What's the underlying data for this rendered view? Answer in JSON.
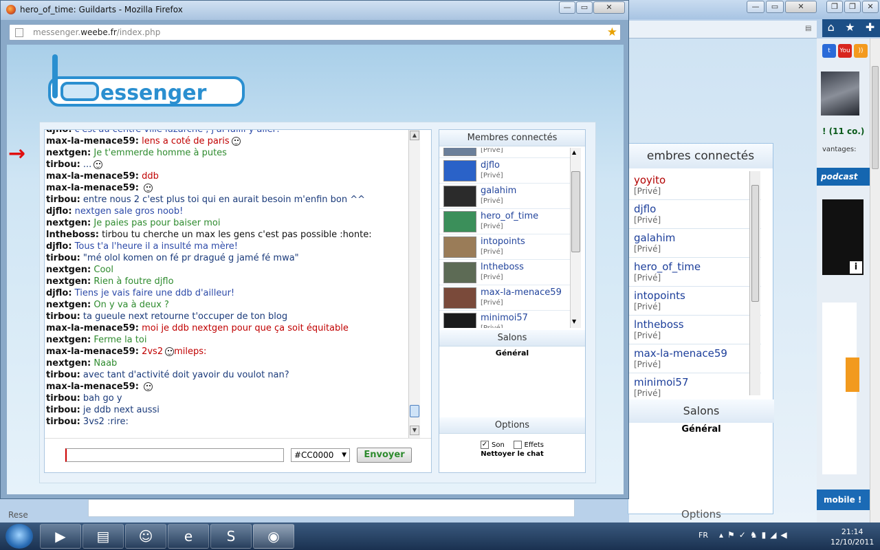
{
  "background_window": {
    "members_title": "embres connectés",
    "members": [
      {
        "name": "yoyito",
        "status": "[Privé]",
        "color": "#b20000"
      },
      {
        "name": "djflo",
        "status": "[Privé]",
        "color": "#1c3e9a"
      },
      {
        "name": "galahim",
        "status": "[Privé]",
        "color": "#1c3e9a"
      },
      {
        "name": "hero_of_time",
        "status": "[Privé]",
        "color": "#1c3e9a"
      },
      {
        "name": "intopoints",
        "status": "[Privé]",
        "color": "#1c3e9a"
      },
      {
        "name": "lntheboss",
        "status": "[Privé]",
        "color": "#1c3e9a"
      },
      {
        "name": "max-la-menace59",
        "status": "[Privé]",
        "color": "#1c3e9a"
      },
      {
        "name": "minimoi57",
        "status": "[Privé]",
        "color": "#1c3e9a"
      }
    ],
    "salons_title": "Salons",
    "general": "Général",
    "options_title": "Options",
    "online_count": "! (11 co.)",
    "advantages": "vantages:",
    "podcast": "podcast",
    "mobile": "mobile !",
    "bottom_text": "Rese"
  },
  "firefox": {
    "window_title": "hero_of_time: Guildarts - Mozilla Firefox",
    "url_prefix": "messenger.",
    "url_domain": "weebe.fr",
    "url_path": "/index.php"
  },
  "chat": {
    "messages": [
      {
        "user": "djflo:",
        "text": "c'est au centre ville luzarche , j'ai failli y aller!",
        "color": "#2c4aa8",
        "smiley": false
      },
      {
        "user": "max-la-menace59:",
        "text": "lens a coté de paris",
        "color": "#c00000",
        "smiley": true
      },
      {
        "user": "nextgen:",
        "text": "Je t'emmerde homme à putes",
        "color": "#2e8b2e",
        "smiley": false
      },
      {
        "user": "tirbou:",
        "text": "...",
        "color": "#1a3a7a",
        "smiley": true
      },
      {
        "user": "max-la-menace59:",
        "text": "ddb",
        "color": "#c00000",
        "smiley": false
      },
      {
        "user": "max-la-menace59:",
        "text": "",
        "color": "#c00000",
        "smiley": true
      },
      {
        "user": "tirbou:",
        "text": "entre nous 2 c'est plus toi qui en aurait besoin m'enfin bon ^^",
        "color": "#1a3a7a",
        "smiley": false
      },
      {
        "user": "djflo:",
        "text": "nextgen sale gros noob!",
        "color": "#2c4aa8",
        "smiley": false
      },
      {
        "user": "nextgen:",
        "text": "Je paies pas pour baiser moi",
        "color": "#2e8b2e",
        "smiley": false
      },
      {
        "user": "lntheboss:",
        "text": "tirbou tu cherche un max les gens c'est pas possible :honte:",
        "color": "#111111",
        "smiley": false
      },
      {
        "user": "djflo:",
        "text": "Tous t'a l'heure il a insulté ma mère!",
        "color": "#2c4aa8",
        "smiley": false
      },
      {
        "user": "tirbou:",
        "text": "\"mé olol komen on fé pr dragué g jamé fé mwa\"",
        "color": "#1a3a7a",
        "smiley": false
      },
      {
        "user": "nextgen:",
        "text": "Cool",
        "color": "#2e8b2e",
        "smiley": false
      },
      {
        "user": "nextgen:",
        "text": "Rien à foutre djflo",
        "color": "#2e8b2e",
        "smiley": false
      },
      {
        "user": "djflo:",
        "text": "Tiens je vais faire une ddb d'ailleur!",
        "color": "#2c4aa8",
        "smiley": false
      },
      {
        "user": "nextgen:",
        "text": "On y va à deux ?",
        "color": "#2e8b2e",
        "smiley": false
      },
      {
        "user": "tirbou:",
        "text": "ta gueule next retourne t'occuper de ton blog",
        "color": "#1a3a7a",
        "smiley": false
      },
      {
        "user": "max-la-menace59:",
        "text": "moi je ddb nextgen pour que ça soit équitable",
        "color": "#c00000",
        "smiley": false
      },
      {
        "user": "nextgen:",
        "text": "Ferme la toi",
        "color": "#2e8b2e",
        "smiley": false
      },
      {
        "user": "max-la-menace59:",
        "text": "2vs2",
        "color": "#c00000",
        "smiley": true,
        "after": "mileps:"
      },
      {
        "user": "nextgen:",
        "text": "Naab",
        "color": "#2e8b2e",
        "smiley": false
      },
      {
        "user": "tirbou:",
        "text": "avec tant d'activité doit yavoir du voulot nan?",
        "color": "#1a3a7a",
        "smiley": false
      },
      {
        "user": "max-la-menace59:",
        "text": "",
        "color": "#c00000",
        "smiley": true
      },
      {
        "user": "tirbou:",
        "text": "bah go y",
        "color": "#1a3a7a",
        "smiley": false
      },
      {
        "user": "tirbou:",
        "text": "je ddb next aussi",
        "color": "#1a3a7a",
        "smiley": false
      },
      {
        "user": "tirbou:",
        "text": "3vs2 :rire:",
        "color": "#1a3a7a",
        "smiley": false
      }
    ],
    "input_value": "",
    "color_value": "#CC0000",
    "send_label": "Envoyer"
  },
  "sidebar": {
    "members_title": "Membres connectés",
    "members": [
      {
        "name": "",
        "status": "[Privé]",
        "avatar": "#6b7f9a"
      },
      {
        "name": "djflo",
        "status": "[Privé]",
        "avatar": "#2a62c8"
      },
      {
        "name": "galahim",
        "status": "[Privé]",
        "avatar": "#2b2b2b"
      },
      {
        "name": "hero_of_time",
        "status": "[Privé]",
        "avatar": "#3b8f5a"
      },
      {
        "name": "intopoints",
        "status": "[Privé]",
        "avatar": "#9a7c58"
      },
      {
        "name": "lntheboss",
        "status": "[Privé]",
        "avatar": "#5d6b55"
      },
      {
        "name": "max-la-menace59",
        "status": "[Privé]",
        "avatar": "#7a4a3a"
      },
      {
        "name": "minimoi57",
        "status": "[Privé]",
        "avatar": "#1b1b1b"
      }
    ],
    "salons_title": "Salons",
    "general": "Général",
    "options_title": "Options",
    "son_label": "Son",
    "effets_label": "Effets",
    "clear_label": "Nettoyer le chat"
  },
  "taskbar": {
    "lang": "FR",
    "time": "21:14",
    "date": "12/10/2011"
  }
}
